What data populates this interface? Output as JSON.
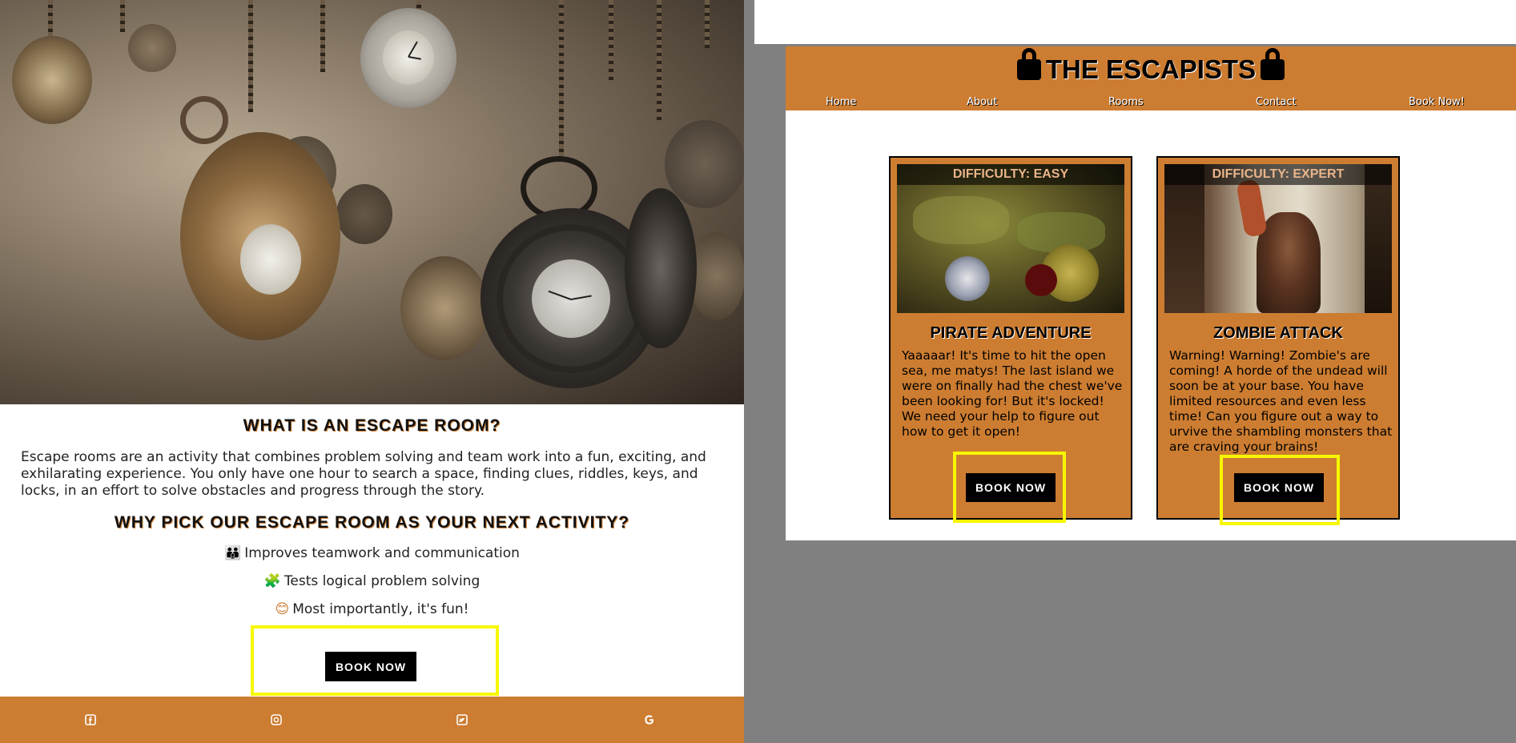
{
  "home_page": {
    "what_heading": "What is an escape room?",
    "what_text": "Escape rooms are an activity that combines problem solving and team work into a fun, exciting, and exhilarating experience. You only have one hour to search a space, finding clues, riddles, keys, and locks, in an effort to solve obstacles and progress through the story.",
    "why_heading": "Why pick our escape room as your next activity?",
    "benefits": [
      {
        "icon": "people-group-icon",
        "glyph": "👪",
        "text": "Improves teamwork and communication"
      },
      {
        "icon": "puzzle-piece-icon",
        "glyph": "🧩",
        "text": "Tests logical problem solving"
      },
      {
        "icon": "smile-icon",
        "glyph": "😊",
        "text": "Most importantly, it's fun!"
      }
    ],
    "book_button": "Book Now",
    "footer_icons": [
      "facebook-icon",
      "instagram-icon",
      "twitter-icon",
      "google-icon"
    ]
  },
  "rooms_page": {
    "brand": "The Escapists",
    "nav": [
      "Home",
      "About",
      "Rooms",
      "Contact",
      "Book Now!"
    ],
    "cards": [
      {
        "difficulty": "Difficulty: Easy",
        "title": "Pirate Adventure",
        "text": "Yaaaaar! It's time to hit the open sea, me matys! The last island we were on finally had the chest we've been looking for! But it's locked! We need your help to figure out how to get it open!",
        "button": "Book Now"
      },
      {
        "difficulty": "Difficulty: Expert",
        "title": "Zombie Attack",
        "text": "Warning! Warning! Zombie's are coming! A horde of the undead will soon be at your base. You have limited resources and even less time! Can you figure out a way to urvive the shambling monsters that are craving your brains!",
        "button": "Book Now"
      }
    ]
  },
  "colors": {
    "brand_orange": "#cd7d31",
    "highlight_yellow": "#f7f700",
    "button_black": "#000000",
    "panel_gray": "#808080"
  }
}
